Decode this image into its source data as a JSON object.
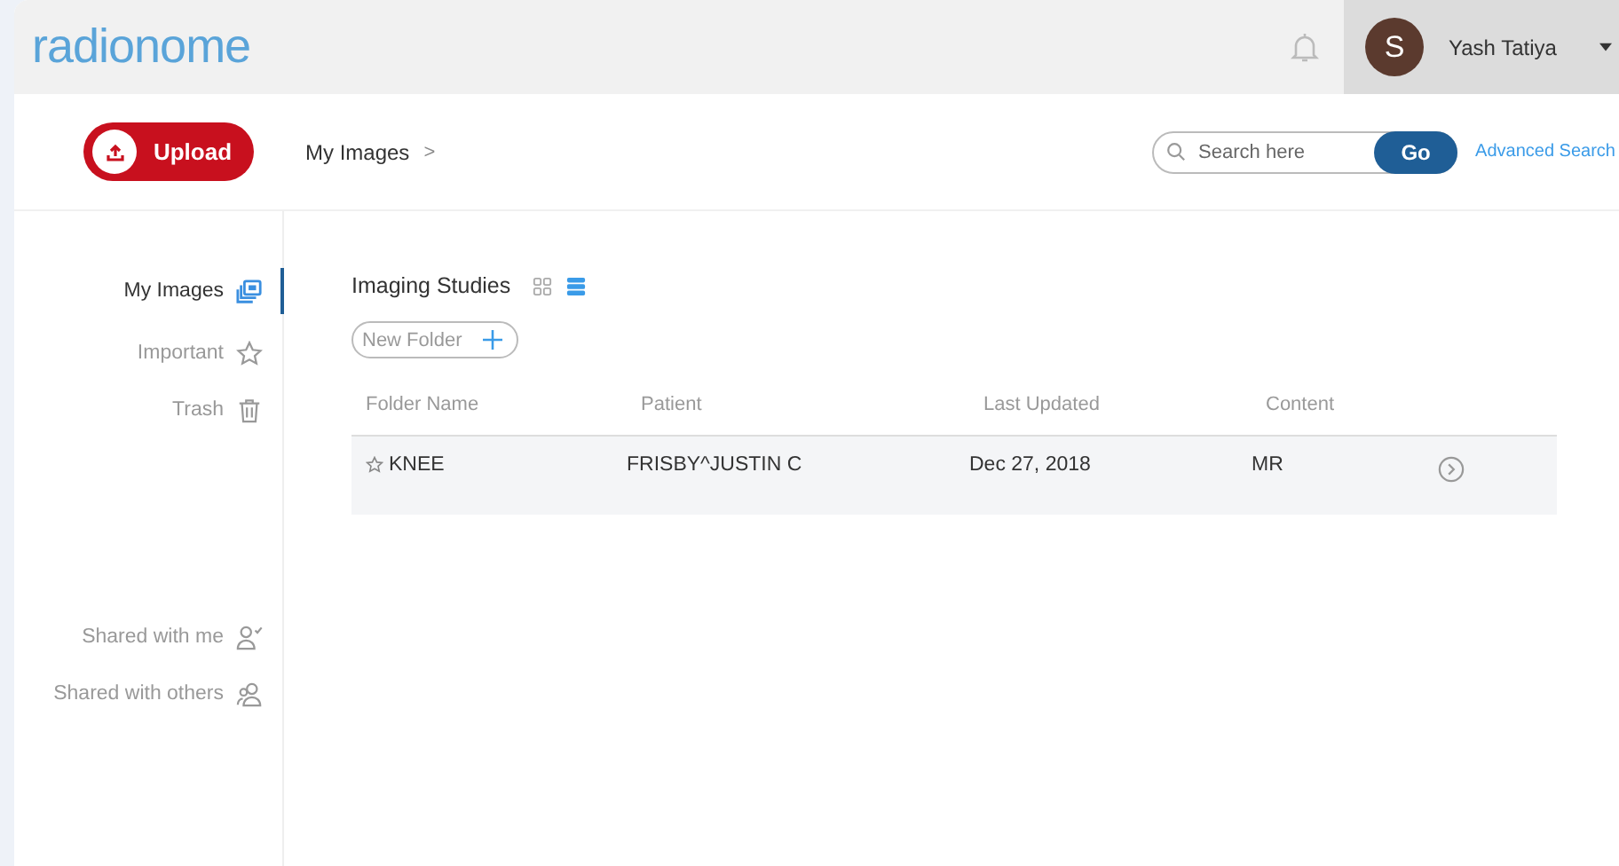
{
  "logo": "radionome",
  "user": {
    "initial": "S",
    "name": "Yash Tatiya"
  },
  "upload_button": "Upload",
  "breadcrumb": {
    "label": "My Images",
    "separator": ">"
  },
  "search": {
    "placeholder": "Search here",
    "button": "Go",
    "advanced_link": "Advanced Search"
  },
  "sidebar": {
    "items": [
      {
        "label": "My Images",
        "kind": "images",
        "selected": true
      },
      {
        "label": "Important",
        "kind": "star",
        "selected": false
      },
      {
        "label": "Trash",
        "kind": "trash",
        "selected": false
      }
    ],
    "shared_items": [
      {
        "label": "Shared with me",
        "kind": "user-check",
        "selected": false
      },
      {
        "label": "Shared with others",
        "kind": "users",
        "selected": false
      }
    ]
  },
  "content": {
    "title": "Imaging Studies",
    "views": [
      {
        "kind": "grid",
        "selected": false
      },
      {
        "kind": "list",
        "selected": true
      }
    ],
    "new_folder_button": "New Folder",
    "table": {
      "columns": [
        "Folder Name",
        "Patient",
        "Last Updated",
        "Content"
      ],
      "rows": [
        {
          "starred": false,
          "cells": [
            "KNEE",
            "FRISBY^JUSTIN C",
            "Dec 27, 2018",
            "MR"
          ]
        }
      ]
    }
  }
}
